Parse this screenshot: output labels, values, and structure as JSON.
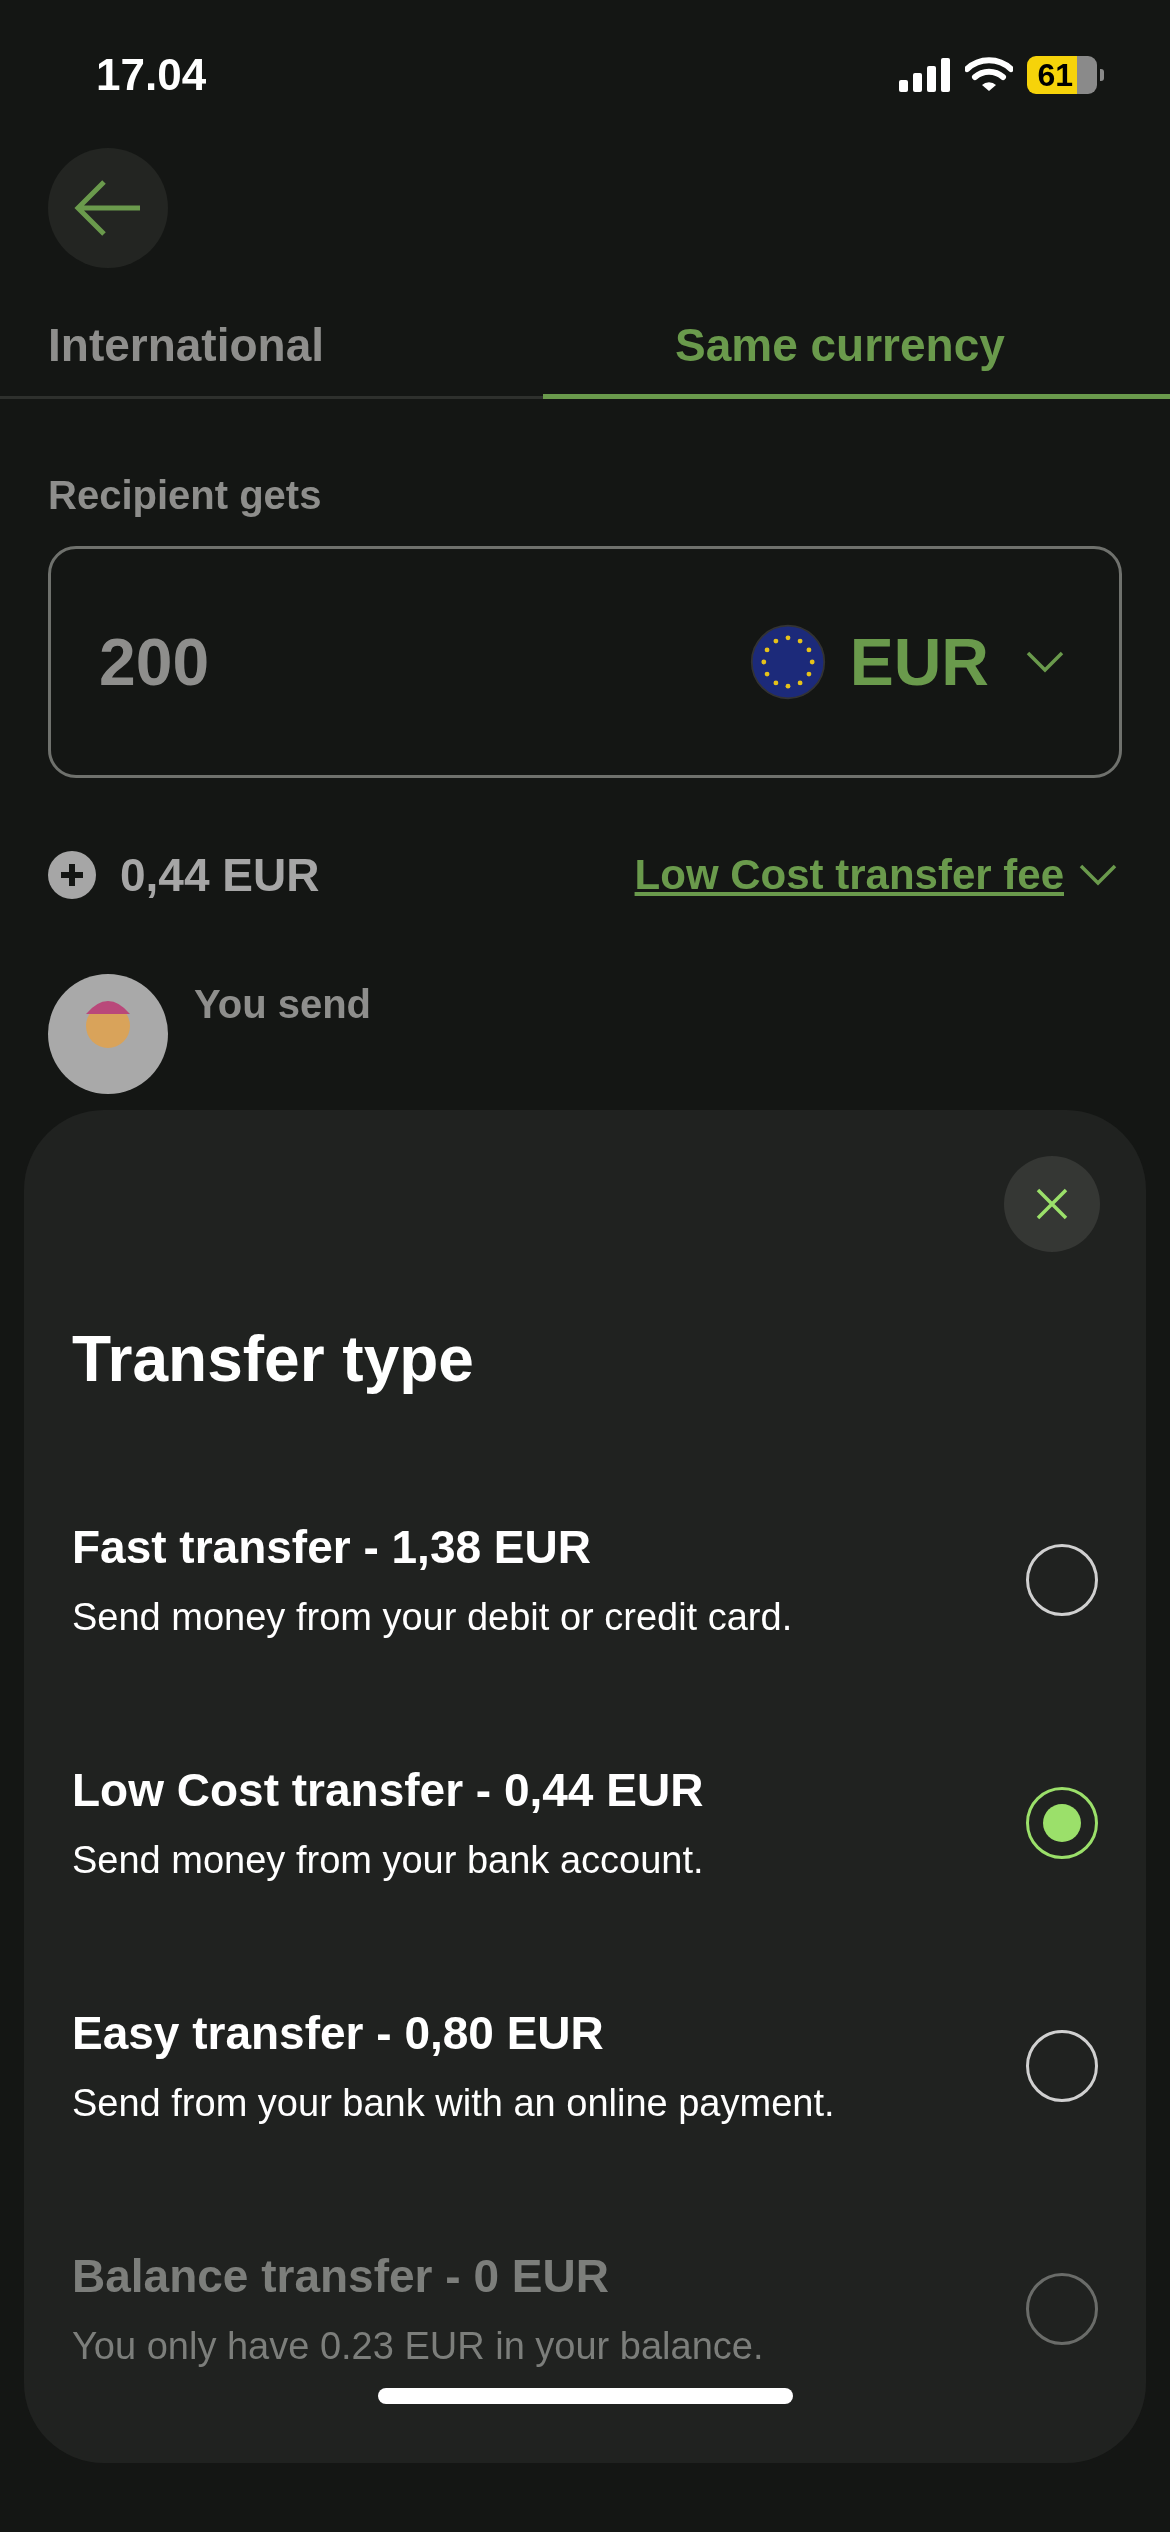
{
  "status_bar": {
    "time": "17.04",
    "battery": "61"
  },
  "tabs": [
    {
      "label": "International",
      "selected": false
    },
    {
      "label": "Same currency",
      "selected": true
    }
  ],
  "recipient": {
    "label": "Recipient gets",
    "amount": "200",
    "currency": "EUR"
  },
  "fee": {
    "amount": "0,44 EUR",
    "link": "Low Cost transfer fee"
  },
  "sender": {
    "label": "You send"
  },
  "sheet": {
    "title": "Transfer type",
    "options": [
      {
        "title": "Fast transfer - 1,38 EUR",
        "description": "Send money from your debit or credit card.",
        "selected": false,
        "disabled": false
      },
      {
        "title": "Low Cost transfer - 0,44 EUR",
        "description": "Send money from your bank account.",
        "selected": true,
        "disabled": false
      },
      {
        "title": "Easy transfer - 0,80 EUR",
        "description": "Send from your bank with an online payment.",
        "selected": false,
        "disabled": false
      },
      {
        "title": "Balance transfer - 0 EUR",
        "description": "You only have 0.23 EUR in your balance.",
        "selected": false,
        "disabled": true
      }
    ]
  }
}
